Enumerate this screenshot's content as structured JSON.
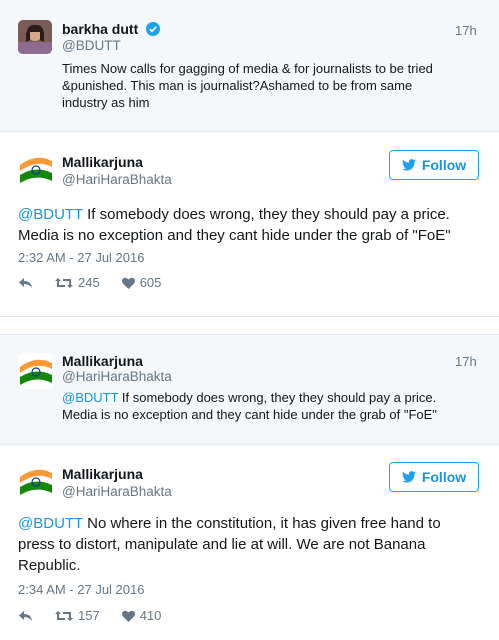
{
  "tweet1": {
    "name": "barkha dutt",
    "handle": "@BDUTT",
    "time": "17h",
    "text_line1": "Times Now calls for gagging of media & for journalists to be tried",
    "text_line2": "&punished. This man is journalist?Ashamed to be from same",
    "text_line3": "industry as him"
  },
  "tweet2": {
    "name": "Mallikarjuna",
    "handle": "@HariHaraBhakta",
    "follow_label": "Follow",
    "mention": "@BDUTT",
    "text_line1_rest": " If somebody does wrong, they they should pay a price.",
    "text_line2": "Media is no exception and they cant hide under the grab of \"FoE\"",
    "date": "2:32 AM - 27 Jul 2016",
    "retweets": "245",
    "likes": "605"
  },
  "tweet3": {
    "name": "Mallikarjuna",
    "handle": "@HariHaraBhakta",
    "time": "17h",
    "mention": "@BDUTT",
    "text_line1_rest": " If somebody does wrong, they they should pay a price.",
    "text_line2": "Media is no exception and they cant hide under the grab of \"FoE\""
  },
  "tweet4": {
    "name": "Mallikarjuna",
    "handle": "@HariHaraBhakta",
    "follow_label": "Follow",
    "mention": "@BDUTT",
    "text_line1_rest": " No where in the constitution, it has given free hand to",
    "text_line2": "press to distort, manipulate and lie at will. We are not Banana",
    "text_line3": "Republic.",
    "date": "2:34 AM - 27 Jul 2016",
    "retweets": "157",
    "likes": "410"
  },
  "colors": {
    "accent": "#1b95e0",
    "gray_bg": "#f5f8fa",
    "saffron": "#ff9933",
    "green": "#138808"
  }
}
